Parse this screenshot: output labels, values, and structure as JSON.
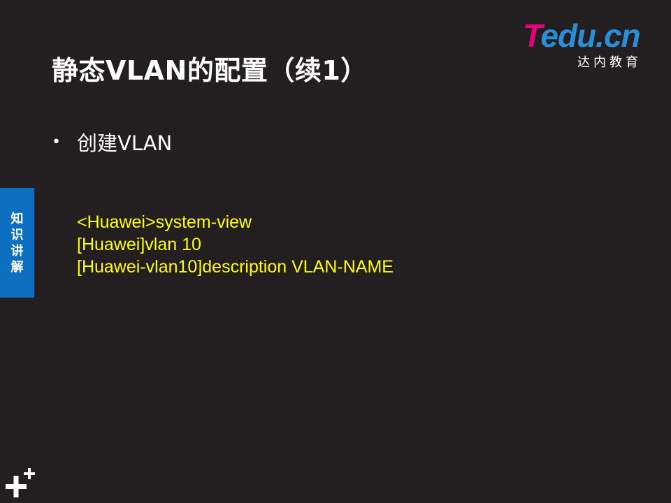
{
  "slide": {
    "title": "静态VLAN的配置（续1）",
    "logo": {
      "brand_first": "T",
      "brand_rest": "edu.cn",
      "subtitle": "达内教育"
    },
    "bullet": {
      "text": "创建VLAN"
    },
    "code_lines": [
      "<Huawei>system-view",
      "[Huawei]vlan 10",
      "[Huawei-vlan10]description VLAN-NAME"
    ],
    "side_tab": {
      "chars": [
        "知",
        "识",
        "讲",
        "解"
      ]
    },
    "colors": {
      "background": "#231f20",
      "code": "#ffff00",
      "side_tab": "#0c6fc0",
      "logo_pink": "#e6007e",
      "logo_blue": "#2a8fd6"
    },
    "icons": {
      "corner_mark": "plus-cluster-icon"
    }
  }
}
